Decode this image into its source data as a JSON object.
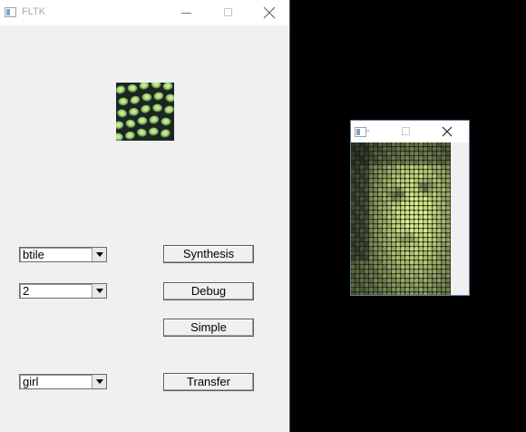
{
  "main_window": {
    "title": "FLTK",
    "controls": {
      "minimize": "minimize-icon",
      "maximize": "maximize-icon",
      "close": "close-icon"
    },
    "texture_preview": "texture-thumbnail",
    "choices": [
      {
        "name": "texture-choice",
        "value": "btile"
      },
      {
        "name": "level-choice",
        "value": "2"
      },
      {
        "name": "target-choice",
        "value": "girl"
      }
    ],
    "buttons": {
      "synthesis": "Synthesis",
      "debug": "Debug",
      "simple": "Simple",
      "transfer": "Transfer"
    }
  },
  "result_window": {
    "title": "-",
    "image": "texture-transfer-result"
  },
  "colors": {
    "desktop": "#000000",
    "window_bg": "#f0f0f0",
    "texture_green": "#b8e08a",
    "texture_dark": "#1e2a22"
  }
}
